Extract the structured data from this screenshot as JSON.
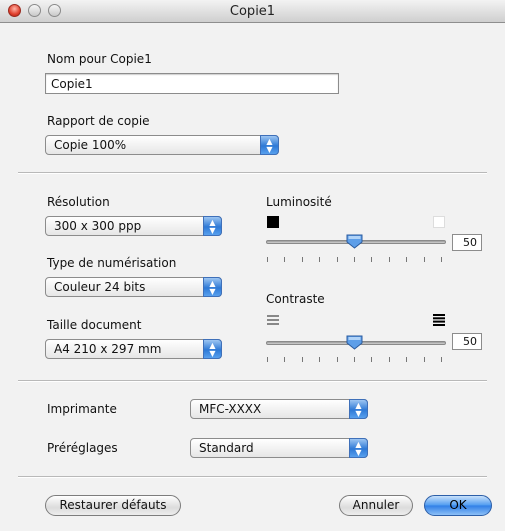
{
  "window": {
    "title": "Copie1"
  },
  "name_section": {
    "label": "Nom pour Copie1",
    "value": "Copie1"
  },
  "copy_ratio": {
    "label": "Rapport de copie",
    "selected": "Copie 100%"
  },
  "resolution": {
    "label": "Résolution",
    "selected": "300 x 300 ppp"
  },
  "scan_type": {
    "label": "Type de numérisation",
    "selected": "Couleur 24 bits"
  },
  "doc_size": {
    "label": "Taille document",
    "selected": "A4 210 x 297 mm"
  },
  "brightness": {
    "label": "Luminosité",
    "value": "50",
    "level_fraction": 0.5
  },
  "contrast": {
    "label": "Contraste",
    "value": "50",
    "level_fraction": 0.5
  },
  "printer": {
    "label": "Imprimante",
    "selected": "MFC-XXXX"
  },
  "presets": {
    "label": "Préréglages",
    "selected": "Standard"
  },
  "buttons": {
    "restore": "Restaurer défauts",
    "cancel": "Annuler",
    "ok": "OK"
  },
  "colors": {
    "accent": "#2f7ee6",
    "window_bg": "#f2f2f2"
  }
}
